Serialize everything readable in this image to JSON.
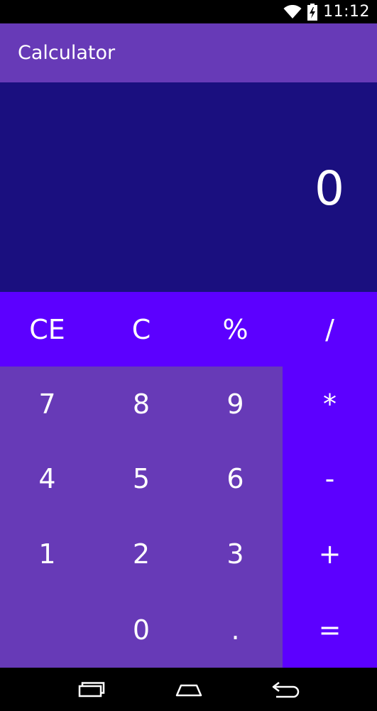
{
  "status_bar": {
    "time": "11:12",
    "icons": [
      "wifi-icon",
      "battery-charging-icon"
    ]
  },
  "app_bar": {
    "title": "Calculator"
  },
  "display": {
    "value": "0"
  },
  "keypad": {
    "keys": [
      {
        "label": "CE",
        "type": "fn"
      },
      {
        "label": "C",
        "type": "fn"
      },
      {
        "label": "%",
        "type": "fn"
      },
      {
        "label": "/",
        "type": "op"
      },
      {
        "label": "7",
        "type": "num"
      },
      {
        "label": "8",
        "type": "num"
      },
      {
        "label": "9",
        "type": "num"
      },
      {
        "label": "*",
        "type": "op"
      },
      {
        "label": "4",
        "type": "num"
      },
      {
        "label": "5",
        "type": "num"
      },
      {
        "label": "6",
        "type": "num"
      },
      {
        "label": "-",
        "type": "op"
      },
      {
        "label": "1",
        "type": "num"
      },
      {
        "label": "2",
        "type": "num"
      },
      {
        "label": "3",
        "type": "num"
      },
      {
        "label": "+",
        "type": "op"
      },
      {
        "label": "",
        "type": "num"
      },
      {
        "label": "0",
        "type": "num"
      },
      {
        "label": ".",
        "type": "num"
      },
      {
        "label": "=",
        "type": "op"
      }
    ]
  },
  "nav_bar": {
    "buttons": [
      "recent-apps-icon",
      "home-icon",
      "back-icon"
    ]
  },
  "colors": {
    "app_bar": "#673ab7",
    "display": "#1a0f7f",
    "function_keys": "#5c00ff",
    "number_keys": "#673ab7"
  }
}
